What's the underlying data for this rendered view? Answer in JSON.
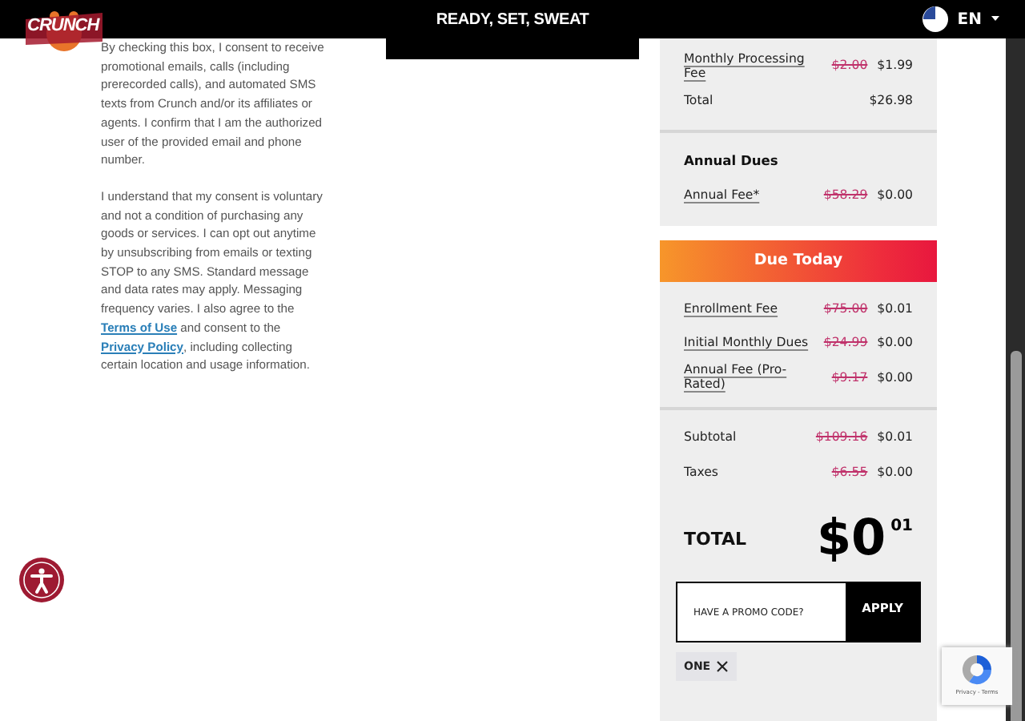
{
  "header": {
    "logo": "CRUNCH",
    "title": "READY, SET, SWEAT",
    "language": "EN"
  },
  "consent": [
    [
      {
        "kind": "text",
        "text": "By checking this box, I consent to receive promotional emails, calls (including prerecorded calls), and automated SMS texts from Crunch and/or its affiliates or agents. I confirm that I am the authorized user of the provided email and phone number."
      }
    ],
    [
      {
        "kind": "text",
        "text": "I understand that my consent is voluntary and not a condition of purchasing any goods or services. I can opt out anytime by unsubscribing from emails or texting STOP to any SMS. Standard message and data rates may apply. Messaging frequency varies. I also agree to the "
      },
      {
        "kind": "link",
        "text": "Terms of Use"
      },
      {
        "kind": "text",
        "text": " and consent to the "
      },
      {
        "kind": "link",
        "text": "Privacy Policy"
      },
      {
        "kind": "text",
        "text": ", including collecting certain location and usage information."
      }
    ]
  ],
  "monthly": {
    "rows": [
      {
        "label": "Monthly Processing Fee",
        "original": "$2.00",
        "price": "$1.99"
      }
    ],
    "total": {
      "label": "Total",
      "value": "$26.98"
    }
  },
  "annual_dues": {
    "heading": "Annual Dues",
    "rows": [
      {
        "label": "Annual Fee*",
        "original": "$58.29",
        "price": "$0.00"
      }
    ]
  },
  "due_today": {
    "heading": "Due Today",
    "rows": [
      {
        "label": "Enrollment Fee",
        "original": "$75.00",
        "price": "$0.01"
      },
      {
        "label": "Initial Monthly Dues",
        "original": "$24.99",
        "price": "$0.00"
      },
      {
        "label": "Annual Fee (Pro-Rated)",
        "original": "$9.17",
        "price": "$0.00"
      }
    ],
    "summary": [
      {
        "label": "Subtotal",
        "original": "$109.16",
        "price": "$0.01"
      },
      {
        "label": "Taxes",
        "original": "$6.55",
        "price": "$0.00"
      }
    ],
    "total": {
      "label": "TOTAL",
      "dollars": "$0",
      "cents": "01"
    }
  },
  "promo": {
    "placeholder": "HAVE A PROMO CODE?",
    "button": "APPLY"
  },
  "applied_codes": [
    {
      "code": "ONE"
    }
  ],
  "recaptcha": {
    "links": "Privacy - Terms"
  }
}
